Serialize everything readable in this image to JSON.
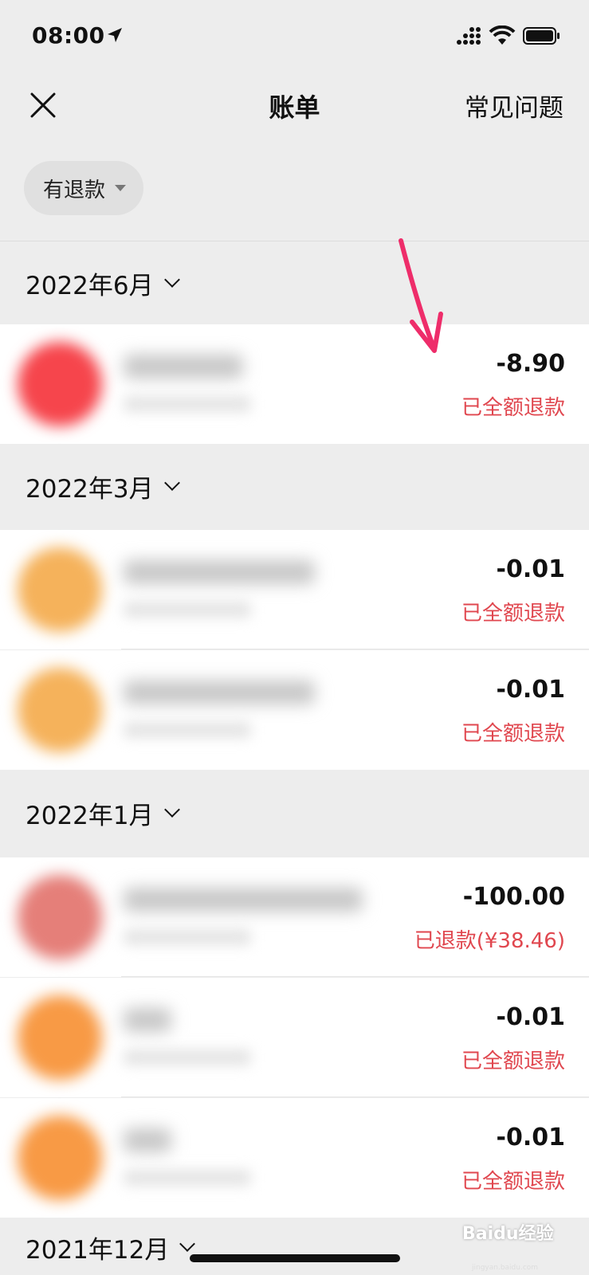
{
  "status_bar": {
    "time": "08:00"
  },
  "nav": {
    "title": "账单",
    "faq": "常见问题"
  },
  "filter": {
    "label": "有退款"
  },
  "months": {
    "jun2022": "2022年6月",
    "mar2022": "2022年3月",
    "jan2022": "2022年1月",
    "dec2021": "2021年12月"
  },
  "transactions": [
    {
      "amount": "-8.90",
      "status": "已全额退款",
      "avatar_color": "#f6454c"
    },
    {
      "amount": "-0.01",
      "status": "已全额退款",
      "avatar_color": "#f5b25b"
    },
    {
      "amount": "-0.01",
      "status": "已全额退款",
      "avatar_color": "#f5b25b"
    },
    {
      "amount": "-100.00",
      "status": "已退款(¥38.46)",
      "avatar_color": "#e57f79"
    },
    {
      "amount": "-0.01",
      "status": "已全额退款",
      "avatar_color": "#f89a45"
    },
    {
      "amount": "-0.01",
      "status": "已全额退款",
      "avatar_color": "#f89a45"
    }
  ],
  "watermark": {
    "brand": "Baidu经验",
    "url": "jingyan.baidu.com"
  },
  "colors": {
    "refund_text": "#e0474f",
    "background": "#ededed",
    "annotation_arrow": "#ee2d6a"
  }
}
